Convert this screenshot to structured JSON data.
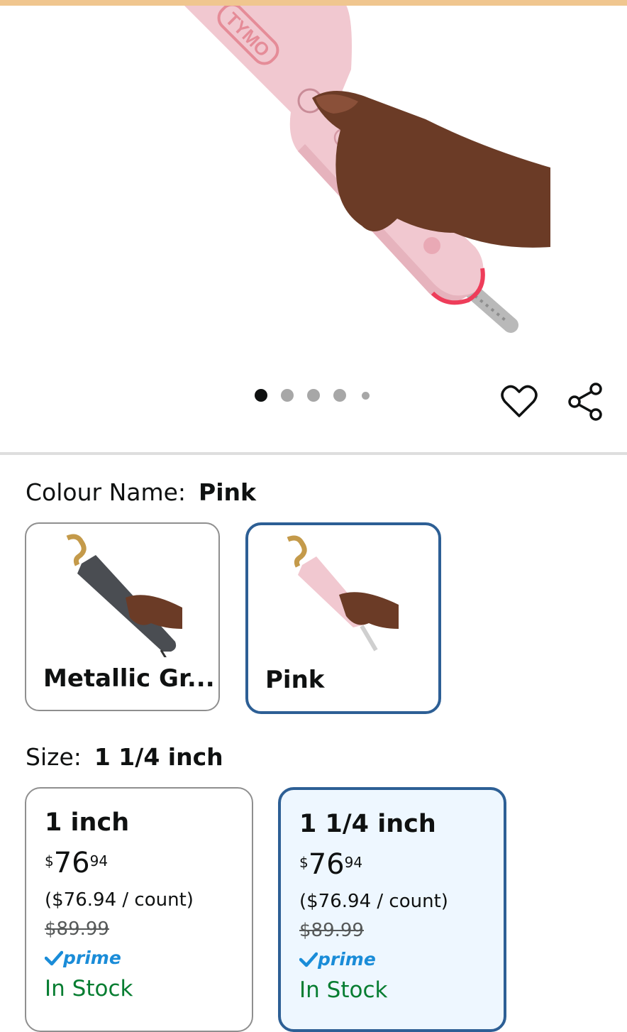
{
  "gallery": {
    "brand_mark": "TYMO",
    "dot_count": 5,
    "active_dot": 0,
    "wishlist_icon": "heart-icon",
    "share_icon": "share-icon"
  },
  "colour": {
    "label": "Colour Name:",
    "selected": "Pink",
    "options": [
      {
        "name": "Metallic Gr...",
        "selected": false,
        "color": "#4a4d52"
      },
      {
        "name": "Pink",
        "selected": true,
        "color": "#f1c8d0"
      }
    ]
  },
  "size": {
    "label": "Size:",
    "selected": "1 1/4 inch",
    "options": [
      {
        "title": "1 inch",
        "currency": "$",
        "whole": "76",
        "fraction": "94",
        "unit_price": "($76.94 / count)",
        "was_price": "$89.99",
        "prime": "prime",
        "stock": "In Stock",
        "selected": false
      },
      {
        "title": "1 1/4 inch",
        "currency": "$",
        "whole": "76",
        "fraction": "94",
        "unit_price": "($76.94 / count)",
        "was_price": "$89.99",
        "prime": "prime",
        "stock": "In Stock",
        "selected": true
      }
    ]
  },
  "colors": {
    "selected_border": "#2d5f95",
    "unselected_border": "#8f8f8f",
    "selected_bg": "#eef7ff",
    "stock_green": "#067d31",
    "prime_blue": "#1a8cd8",
    "top_strip": "#f0c68f"
  }
}
